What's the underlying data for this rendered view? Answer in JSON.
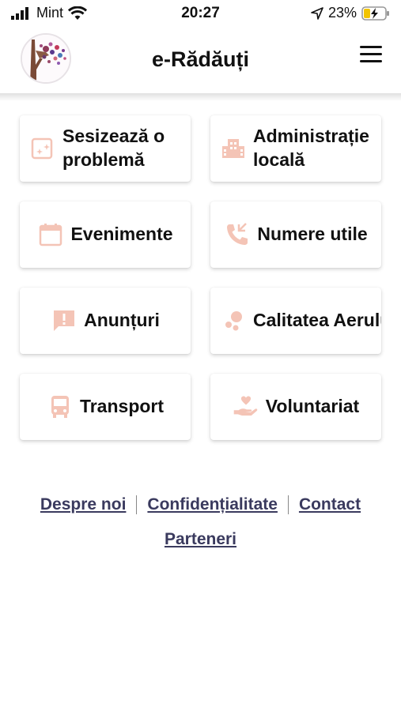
{
  "status_bar": {
    "carrier": "Mint",
    "time": "20:27",
    "battery": "23%",
    "icons": [
      "signal-icon",
      "wifi-icon",
      "location-arrow-icon",
      "battery-charging-icon"
    ]
  },
  "header": {
    "title": "e-Rădăuți",
    "logo_icon": "city-tree-logo",
    "menu_icon": "hamburger-menu-icon"
  },
  "colors": {
    "accent": "#f4c4b6",
    "text": "#111111",
    "link": "#3a3a5e"
  },
  "tiles": [
    {
      "label": "Sesizează o problemă",
      "icon": "report-problem-icon"
    },
    {
      "label": "Administrație locală",
      "icon": "city-buildings-icon"
    },
    {
      "label": "Evenimente",
      "icon": "calendar-icon"
    },
    {
      "label": "Numere utile",
      "icon": "phone-call-icon"
    },
    {
      "label": "Anunțuri",
      "icon": "announcement-icon"
    },
    {
      "label": "Calitatea Aerului",
      "icon": "air-bubbles-icon"
    },
    {
      "label": "Transport",
      "icon": "bus-icon"
    },
    {
      "label": "Voluntariat",
      "icon": "volunteer-hand-heart-icon"
    }
  ],
  "footer": {
    "links": [
      "Despre noi",
      "Confidențialitate",
      "Contact",
      "Parteneri"
    ]
  }
}
